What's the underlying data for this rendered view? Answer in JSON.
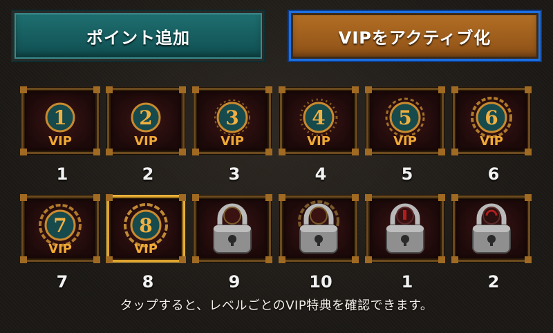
{
  "buttons": {
    "add_points": "ポイント追加",
    "activate_vip": "VIPをアクティブ化"
  },
  "vip_badges": [
    {
      "badge_number": "1",
      "badge_text": "VIP",
      "caption": "1",
      "state": "unlocked"
    },
    {
      "badge_number": "2",
      "badge_text": "VIP",
      "caption": "2",
      "state": "unlocked"
    },
    {
      "badge_number": "3",
      "badge_text": "VIP",
      "caption": "3",
      "state": "unlocked"
    },
    {
      "badge_number": "4",
      "badge_text": "VIP",
      "caption": "4",
      "state": "unlocked"
    },
    {
      "badge_number": "5",
      "badge_text": "VIP",
      "caption": "5",
      "state": "unlocked"
    },
    {
      "badge_number": "6",
      "badge_text": "VIP",
      "caption": "6",
      "state": "unlocked"
    },
    {
      "badge_number": "7",
      "badge_text": "VIP",
      "caption": "7",
      "state": "unlocked"
    },
    {
      "badge_number": "8",
      "badge_text": "VIP",
      "caption": "8",
      "state": "unlocked_selected"
    },
    {
      "badge_number": "",
      "badge_text": "",
      "caption": "9",
      "state": "locked"
    },
    {
      "badge_number": "",
      "badge_text": "",
      "caption": "10",
      "state": "locked"
    },
    {
      "badge_number": "",
      "badge_text": "",
      "caption": "1",
      "state": "locked"
    },
    {
      "badge_number": "",
      "badge_text": "",
      "caption": "2",
      "state": "locked"
    }
  ],
  "hint_text": "タップすると、レベルごとのVIP特典を確認できます。",
  "colors": {
    "teal_button": "#1a6465",
    "orange_button": "#a9661f",
    "selection_border": "#1f6fe0",
    "frame_gold": "#6b4a1e"
  }
}
